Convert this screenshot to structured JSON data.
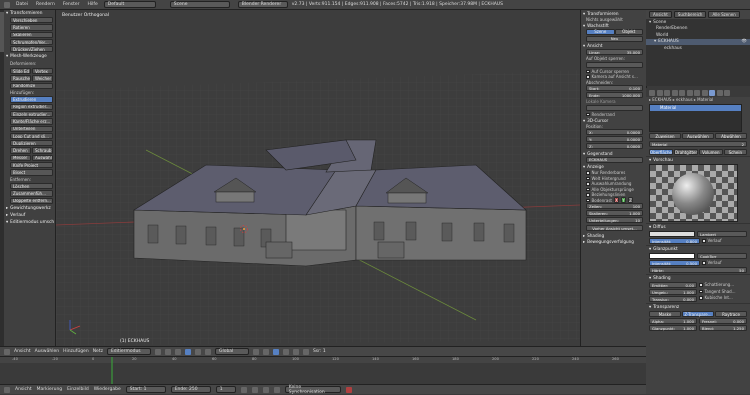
{
  "menubar": {
    "items": [
      "Datei",
      "Rendern",
      "Fenster",
      "Hilfe"
    ],
    "layout": "Default",
    "scene": "Scene",
    "engine": "Blender Renderer",
    "stats": "v2.73 | Verts:911.154 | Edges:911.908 | Faces:5742 | Tris:1.918 | Speicher:37.98M | ECKHAUS"
  },
  "lefttabs": [
    "Werkzeuge",
    "Erstellen",
    "Beziehungen",
    "Animation",
    "Physik",
    "Grease Pencil"
  ],
  "toolshelf": {
    "transform_title": "Transformieren",
    "transform_buttons": [
      "Verschieben",
      "Rotieren",
      "Skalieren",
      "Schrumpfen/Ver...",
      "Drücken/Ziehen"
    ],
    "mesh_title": "Mesh-Werkzeuge",
    "deform_label": "Deformieren:",
    "deform_rows": [
      [
        "Slide Ed",
        "Vertex"
      ],
      [
        "Rauschen",
        "Weicher Vertex"
      ],
      [
        "Randomize"
      ]
    ],
    "add_label": "Hinzufügen:",
    "add_buttons": [
      "Extrudieren",
      "Region extrudier...",
      "Einzeln extrudier...",
      "Kante/Fläche erz...",
      "Unterteilen",
      "Loop Cut and sli...",
      "Duplizieren"
    ],
    "add_rows": [
      [
        "Drehen",
        "Schraub"
      ],
      [
        "Messer",
        "Auswähl"
      ]
    ],
    "add_buttons2": [
      "Knife Project",
      "Bisect"
    ],
    "remove_label": "Entfernen:",
    "remove_buttons": [
      "Löschen",
      "Zusammenfüh...",
      "Doppelte entfern..."
    ],
    "collapsed": [
      "Gewichtungswerkz",
      "Verlauf"
    ],
    "last_op": "Editiermodus umsch"
  },
  "viewport": {
    "title": "Benutzer Orthogonal",
    "object": "(1) ECKHAUS"
  },
  "npanel": {
    "transform_title": "Transformieren",
    "nothing": "Nichts ausgewählt",
    "grease_title": "Wachsstift",
    "grease_tabs": [
      "Szene",
      "Objekt"
    ],
    "grease_new": "Neu",
    "view_title": "Ansicht",
    "lens": [
      "Linse:",
      "35.000"
    ],
    "lock_label": "Auf Objekt sperren:",
    "lock_cursor": "Auf Cursor sperren",
    "lock_camera": "Kamera auf Ansicht s...",
    "clip_label": "Abschneiden:",
    "clip_start": [
      "Start:",
      "0.100"
    ],
    "clip_end": [
      "Ende:",
      "1000.000"
    ],
    "local_camera": "Lokale Kamera",
    "render_border": "Renderrand",
    "cursor_title": "3D-Cursor",
    "position": "Position:",
    "cursor": [
      [
        "X:",
        "0.0000"
      ],
      [
        "Y:",
        "0.0000"
      ],
      [
        "Z:",
        "0.0000"
      ]
    ],
    "item_title": "Gegenstand",
    "item_name": "ECKHAUS",
    "display_title": "Anzeige",
    "display_opts": [
      "Nur Renderbares",
      "Welt Hintergrund",
      "Auswahlumrandung",
      "Alle Objektursprünge",
      "Beziehungslinien"
    ],
    "grid_floor": "Bodenrast",
    "grid_axes": [
      "X",
      "Y",
      "Z"
    ],
    "lines": [
      "Zeilen:",
      "100"
    ],
    "scale": [
      "Skalieren:",
      "1.000"
    ],
    "subdiv": [
      "Unterteilungen:",
      "10"
    ],
    "view_btn": "Vorher Ansicht umset...",
    "shading": "Shading",
    "motion": "Bewegungsverfolgung"
  },
  "outliner": {
    "tabs": [
      "Ansicht",
      "Suchbereich",
      "Alle Szenen"
    ],
    "items": [
      "Scene",
      "RenderEbenen",
      "World",
      "ECKHAUS",
      "eckhaus"
    ]
  },
  "props": {
    "material_slot": "Material",
    "slot_buttons": [
      "Zuweisen",
      "Auswählen",
      "Abwählen"
    ],
    "material_name": "Material",
    "material_count": "2",
    "type_tabs": [
      "Oberfläche",
      "Drahtgitter",
      "Volumen",
      "Schein"
    ],
    "preview_title": "Vorschau",
    "diffuse_title": "Diffus",
    "diffuse_shader": "Lambert",
    "intensity": [
      "Intensität:",
      "0.800"
    ],
    "ramp": "Verlauf",
    "specular_title": "Glanzpunkt",
    "spec_shader": "CookTorr",
    "spec_intensity": [
      "Intensität:",
      "0.500"
    ],
    "hardness": [
      "Härte:",
      "50"
    ],
    "shading_title": "Shading",
    "emit": [
      "Emittier:",
      "0.00"
    ],
    "ambient": [
      "Umgeb.:",
      "1.000"
    ],
    "transl": [
      "Transluc:",
      "0.000"
    ],
    "shading_opts": [
      "Schattierung...",
      "Tangent Shad...",
      "Kubische Int..."
    ],
    "transparency_title": "Transparenz",
    "trans_tabs": [
      "Maske",
      "Z-Transpare...",
      "Raytrace"
    ],
    "alpha": [
      "Alpha:",
      "1.000"
    ],
    "fresnel": [
      "Fresnel:",
      "0.000"
    ],
    "specular2": [
      "Glanzpunkt:",
      "1.000"
    ],
    "blend": [
      "Blend:",
      "1.250"
    ]
  },
  "vpheader": {
    "items": [
      "Ansicht",
      "Auswählen",
      "Hinzufügen",
      "Netz"
    ],
    "mode": "Editiermodus",
    "pivot": "Global",
    "layer": "Ssr: 1"
  },
  "timeline": {
    "ticks": [
      "-40",
      "-20",
      "0",
      "20",
      "40",
      "60",
      "80",
      "100",
      "120",
      "140",
      "160",
      "180",
      "200",
      "220",
      "240",
      "260"
    ]
  },
  "tlheader": {
    "items": [
      "Ansicht",
      "Markierung",
      "Einzelbild",
      "Wiedergabe"
    ],
    "start": [
      "Start:",
      "1"
    ],
    "end": [
      "Ende:",
      "250"
    ],
    "current": "1",
    "sync": "Keine Synchronisation"
  },
  "colors": {
    "accent": "#5680c2",
    "bg": "#3a3a3a",
    "viewport": "#3d3d3d",
    "selected": "#7a9ad1"
  }
}
